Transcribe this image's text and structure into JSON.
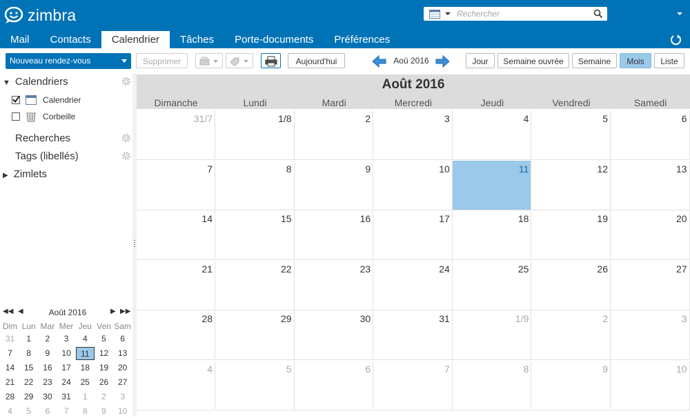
{
  "app": {
    "logo_text": "zimbra"
  },
  "search": {
    "placeholder": "Rechercher"
  },
  "tabs": [
    {
      "label": "Mail",
      "active": false
    },
    {
      "label": "Contacts",
      "active": false
    },
    {
      "label": "Calendrier",
      "active": true
    },
    {
      "label": "Tâches",
      "active": false
    },
    {
      "label": "Porte-documents",
      "active": false
    },
    {
      "label": "Préférences",
      "active": false
    }
  ],
  "toolbar": {
    "new_appointment": "Nouveau rendez-vous",
    "delete": "Supprimer",
    "today": "Aujourd'hui",
    "current_date": "Aoû 2016",
    "views": [
      {
        "label": "Jour",
        "active": false
      },
      {
        "label": "Semaine ouvrée",
        "active": false
      },
      {
        "label": "Semaine",
        "active": false
      },
      {
        "label": "Mois",
        "active": true
      },
      {
        "label": "Liste",
        "active": false
      }
    ]
  },
  "sidebar": {
    "calendars_header": "Calendriers",
    "calendars": [
      {
        "label": "Calendrier",
        "checked": true,
        "icon": "calendar-icon"
      },
      {
        "label": "Corbeille",
        "checked": false,
        "icon": "trash-icon"
      }
    ],
    "searches": "Recherches",
    "tags": "Tags (libellés)",
    "zimlets": "Zimlets"
  },
  "mini_calendar": {
    "title": "Août 2016",
    "weekdays": [
      "Dim",
      "Lun",
      "Mar",
      "Mer",
      "Jeu",
      "Ven",
      "Sam"
    ],
    "weeks": [
      [
        "31",
        "1",
        "2",
        "3",
        "4",
        "5",
        "6"
      ],
      [
        "7",
        "8",
        "9",
        "10",
        "11",
        "12",
        "13"
      ],
      [
        "14",
        "15",
        "16",
        "17",
        "18",
        "19",
        "20"
      ],
      [
        "21",
        "22",
        "23",
        "24",
        "25",
        "26",
        "27"
      ],
      [
        "28",
        "29",
        "30",
        "31",
        "1",
        "2",
        "3"
      ],
      [
        "4",
        "5",
        "6",
        "7",
        "8",
        "9",
        "10"
      ]
    ],
    "today": "11"
  },
  "month_view": {
    "title": "Août 2016",
    "weekdays": [
      "Dimanche",
      "Lundi",
      "Mardi",
      "Mercredi",
      "Jeudi",
      "Vendredi",
      "Samedi"
    ],
    "weeks": [
      [
        "31/7",
        "1/8",
        "2",
        "3",
        "4",
        "5",
        "6"
      ],
      [
        "7",
        "8",
        "9",
        "10",
        "11",
        "12",
        "13"
      ],
      [
        "14",
        "15",
        "16",
        "17",
        "18",
        "19",
        "20"
      ],
      [
        "21",
        "22",
        "23",
        "24",
        "25",
        "26",
        "27"
      ],
      [
        "28",
        "29",
        "30",
        "31",
        "1/9",
        "2",
        "3"
      ],
      [
        "4",
        "5",
        "6",
        "7",
        "8",
        "9",
        "10"
      ]
    ],
    "today": "11"
  },
  "colors": {
    "header": "#0073b7",
    "today": "#9ac9e9",
    "month_header": "#dcdcdc"
  }
}
